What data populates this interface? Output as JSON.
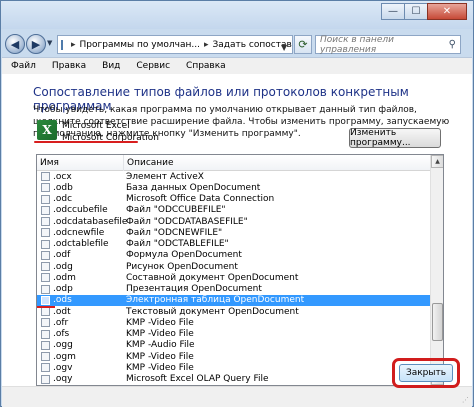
{
  "window": {
    "controls": {
      "minimize": "—",
      "maximize": "☐",
      "close": "✕"
    }
  },
  "navbar": {
    "back_icon": "back-arrow-icon",
    "forward_icon": "forward-arrow-icon",
    "breadcrumb": [
      "Программы по умолчан...",
      "Задать сопоставления"
    ],
    "search_placeholder": "Поиск в панели управления"
  },
  "menu": {
    "items": [
      "Файл",
      "Правка",
      "Вид",
      "Сервис",
      "Справка"
    ]
  },
  "main": {
    "title": "Сопоставление типов файлов или протоколов конкретным программам",
    "description": "Чтобы увидеть, какая программа по умолчанию открывает данный тип файлов, щелкните соответствие расширение файла. Чтобы изменить программу, запускаемую по умолчанию, нажмите кнопку \"Изменить программу\".",
    "program": {
      "name": "Microsoft Excel",
      "company": "Microsoft Corporation",
      "icon_letter": "X"
    },
    "change_button": "Изменить программу...",
    "list": {
      "columns": [
        "Имя",
        "Описание"
      ],
      "rows": [
        {
          "ext": ".ocx",
          "desc": "Элемент ActiveX"
        },
        {
          "ext": ".odb",
          "desc": "База данных OpenDocument"
        },
        {
          "ext": ".odc",
          "desc": "Microsoft Office Data Connection"
        },
        {
          "ext": ".odccubefile",
          "desc": "Файл \"ODCCUBEFILE\""
        },
        {
          "ext": ".odcdatabasefile",
          "desc": "Файл \"ODCDATABASEFILE\""
        },
        {
          "ext": ".odcnewfile",
          "desc": "Файл \"ODCNEWFILE\""
        },
        {
          "ext": ".odctablefile",
          "desc": "Файл \"ODCTABLEFILE\""
        },
        {
          "ext": ".odf",
          "desc": "Формула OpenDocument"
        },
        {
          "ext": ".odg",
          "desc": "Рисунок OpenDocument"
        },
        {
          "ext": ".odm",
          "desc": "Составной документ OpenDocument"
        },
        {
          "ext": ".odp",
          "desc": "Презентация OpenDocument"
        },
        {
          "ext": ".ods",
          "desc": "Электронная таблица OpenDocument",
          "selected": true
        },
        {
          "ext": ".odt",
          "desc": "Текстовый документ OpenDocument"
        },
        {
          "ext": ".ofr",
          "desc": "KMP -Video File"
        },
        {
          "ext": ".ofs",
          "desc": "KMP -Video File"
        },
        {
          "ext": ".ogg",
          "desc": "KMP -Audio File"
        },
        {
          "ext": ".ogm",
          "desc": "KMP -Video File"
        },
        {
          "ext": ".ogv",
          "desc": "KMP -Video File"
        },
        {
          "ext": ".oqy",
          "desc": "Microsoft Excel OLAP Query File"
        }
      ]
    },
    "close_button": "Закрыть"
  },
  "colors": {
    "selection": "#3399ff",
    "heading": "#1e3287",
    "highlight_ring": "#d11d1d"
  }
}
